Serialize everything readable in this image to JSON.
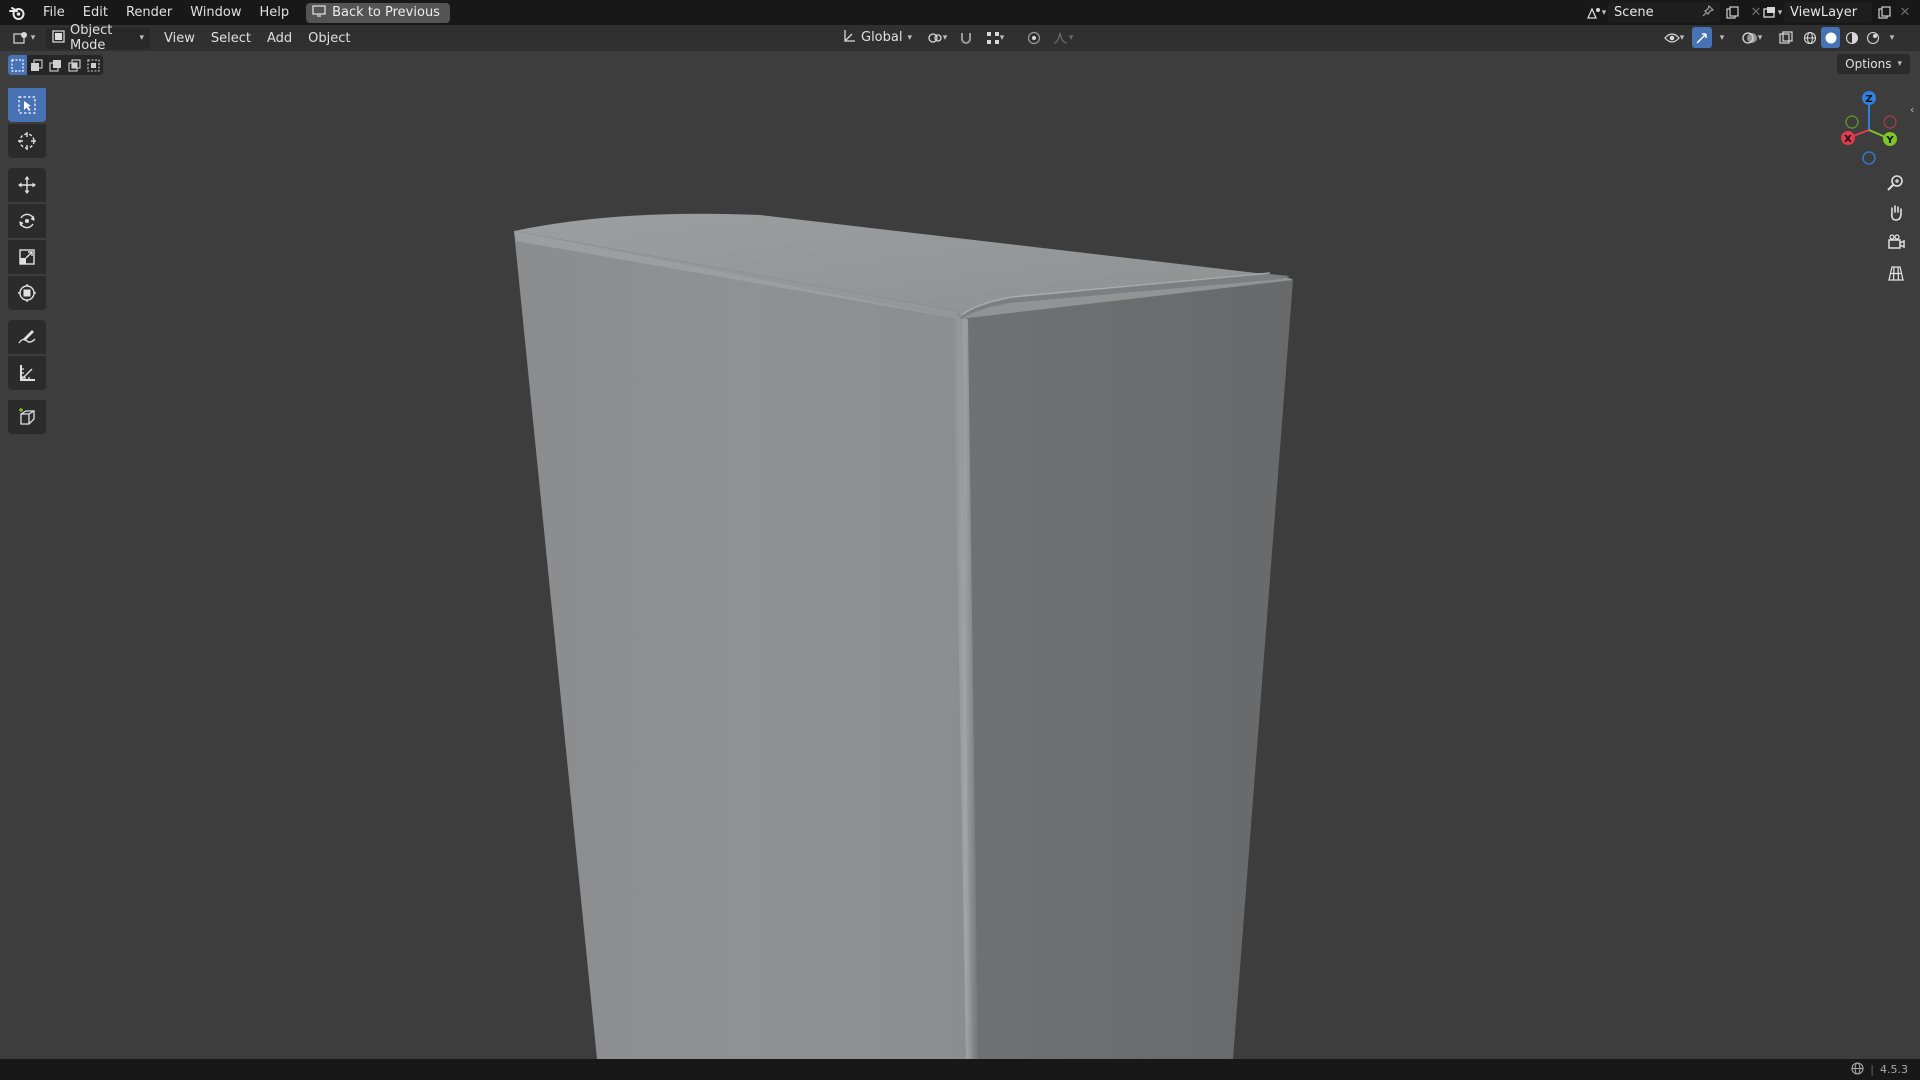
{
  "topbar": {
    "menu": [
      "File",
      "Edit",
      "Render",
      "Window",
      "Help"
    ],
    "back_button": "Back to Previous",
    "scene_name": "Scene",
    "view_layer_name": "ViewLayer"
  },
  "header": {
    "mode": "Object Mode",
    "menus": [
      "View",
      "Select",
      "Add",
      "Object"
    ],
    "transform_orientation": "Global"
  },
  "viewport": {
    "options_label": "Options",
    "gizmo_axes": {
      "z": "Z",
      "x": "X",
      "y": "Y"
    }
  },
  "statusbar": {
    "version": "4.5.3"
  },
  "colors": {
    "accent": "#4772b3",
    "axis_x": "#e23a4f",
    "axis_y": "#7ec526",
    "axis_z": "#2f7fe0",
    "viewport_bg": "#3d3d3d"
  }
}
